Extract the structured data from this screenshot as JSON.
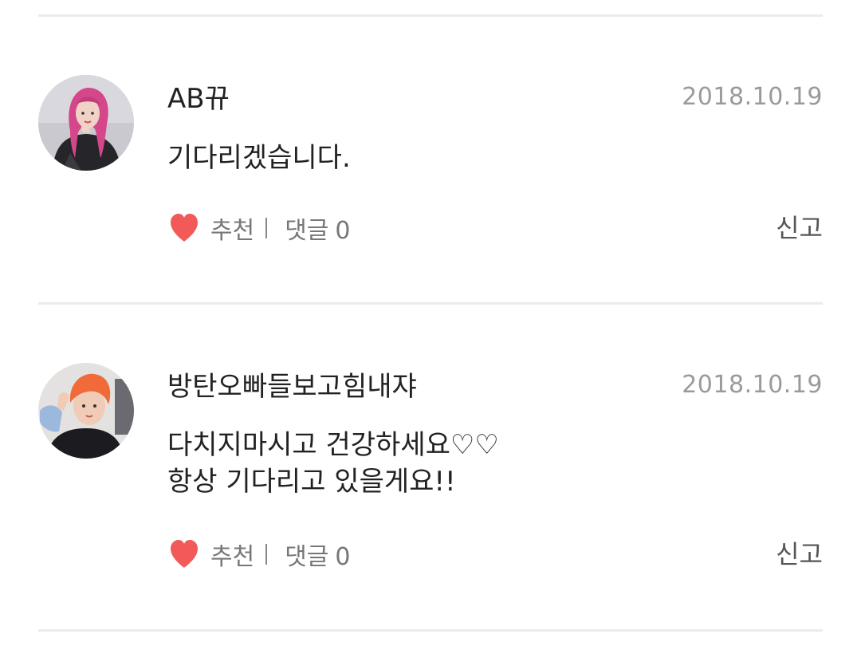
{
  "comments": [
    {
      "nickname": "AB뀨",
      "date": "2018.10.19",
      "body": "기다리겠습니다.",
      "recommend_label": "추천",
      "reply_label": "댓글",
      "reply_count": "0",
      "report_label": "신고"
    },
    {
      "nickname": "방탄오빠들보고힘내쟈",
      "date": "2018.10.19",
      "body": "다치지마시고 건강하세요♡♡\n항상 기다리고 있을게요!!",
      "recommend_label": "추천",
      "reply_label": "댓글",
      "reply_count": "0",
      "report_label": "신고"
    }
  ],
  "colors": {
    "heart": "#f25a5a",
    "divider": "#e9ecee",
    "date": "#9a9a9a",
    "action_text": "#777777"
  },
  "icons": {
    "like": "heart-icon"
  }
}
